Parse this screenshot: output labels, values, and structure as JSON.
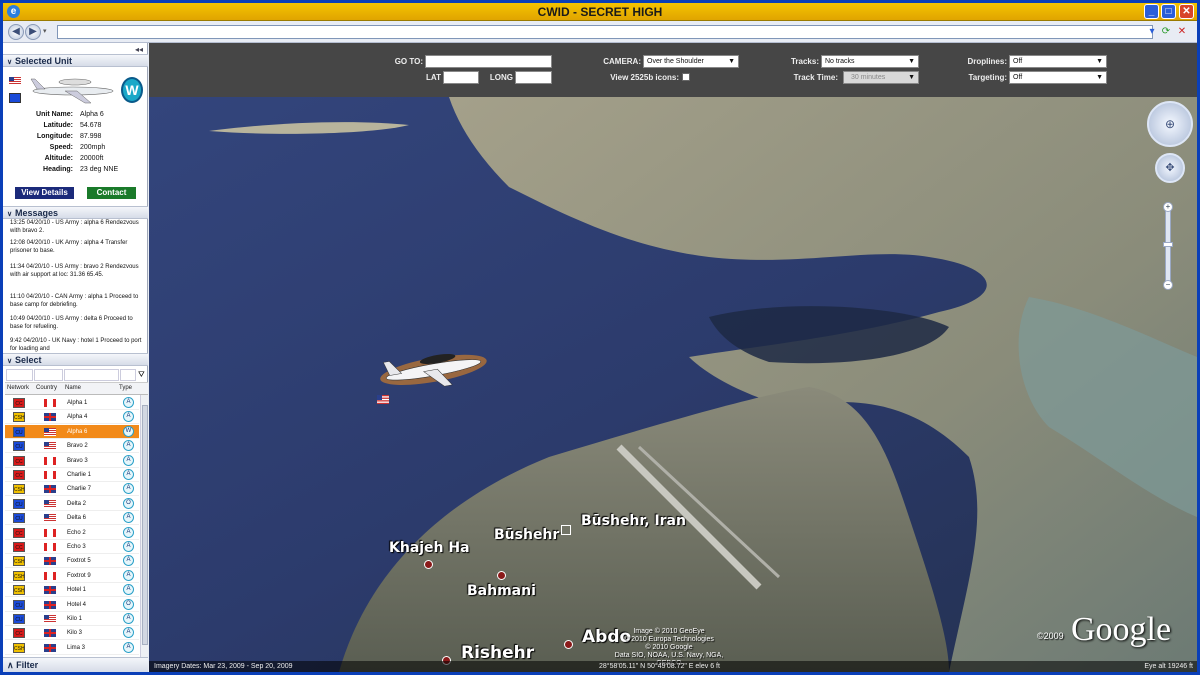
{
  "window": {
    "title": "CWID - SECRET HIGH"
  },
  "sidebar": {
    "selected_unit": {
      "heading": "Selected Unit",
      "role_badge": "W",
      "fields": [
        {
          "label": "Unit Name:",
          "value": "Alpha 6"
        },
        {
          "label": "Latitude:",
          "value": "54.678"
        },
        {
          "label": "Longitude:",
          "value": "87.998"
        },
        {
          "label": "Speed:",
          "value": "200mph"
        },
        {
          "label": "Altitude:",
          "value": "20000ft"
        },
        {
          "label": "Heading:",
          "value": "23 deg NNE"
        }
      ],
      "details_label": "View Details",
      "contact_label": "Contact"
    },
    "messages": {
      "heading": "Messages",
      "items": [
        "13:25 04/20/10 - US Army : alpha 6 Rendezvous with bravo 2.",
        "12:08 04/20/10 - UK Army : alpha 4 Transfer prisoner to base.",
        "11:34 04/20/10 - US Army : bravo 2 Rendezvous with air support at loc: 31.36 65.45.",
        "11:10 04/20/10 - CAN Army : alpha 1 Proceed to base camp for debriefing.",
        "10:49 04/20/10 - US Army : delta 6 Proceed to base for refueling.",
        "9:42 04/20/10 - UK Navy : hotel 1 Proceed to port for loading and"
      ]
    },
    "select": {
      "heading": "Select",
      "columns": [
        "Network",
        "Country",
        "Name",
        "Type"
      ],
      "rows": [
        {
          "network": "CC",
          "country": "ca",
          "name": "Alpha 1",
          "type": "A"
        },
        {
          "network": "CSH",
          "country": "gb",
          "name": "Alpha 4",
          "type": "A"
        },
        {
          "network": "CU",
          "country": "us",
          "name": "Alpha 6",
          "type": "W",
          "selected": true
        },
        {
          "network": "CU",
          "country": "us",
          "name": "Bravo 2",
          "type": "A"
        },
        {
          "network": "CC",
          "country": "ca",
          "name": "Bravo 3",
          "type": "A"
        },
        {
          "network": "CC",
          "country": "ca",
          "name": "Charlie 1",
          "type": "A"
        },
        {
          "network": "CSH",
          "country": "gb",
          "name": "Charlie 7",
          "type": "A"
        },
        {
          "network": "CU",
          "country": "us",
          "name": "Delta 2",
          "type": "O"
        },
        {
          "network": "CU",
          "country": "us",
          "name": "Delta 6",
          "type": "A"
        },
        {
          "network": "CC",
          "country": "ca",
          "name": "Echo 2",
          "type": "A"
        },
        {
          "network": "CC",
          "country": "ca",
          "name": "Echo 3",
          "type": "A"
        },
        {
          "network": "CSH",
          "country": "gb",
          "name": "Foxtrot 5",
          "type": "A"
        },
        {
          "network": "CSH",
          "country": "ca",
          "name": "Foxtrot 9",
          "type": "A"
        },
        {
          "network": "CSH",
          "country": "gb",
          "name": "Hotel 1",
          "type": "A"
        },
        {
          "network": "CU",
          "country": "gb",
          "name": "Hotel 4",
          "type": "O"
        },
        {
          "network": "CU",
          "country": "us",
          "name": "Kilo 1",
          "type": "A"
        },
        {
          "network": "CC",
          "country": "gb",
          "name": "Kilo 3",
          "type": "A"
        },
        {
          "network": "CSH",
          "country": "gb",
          "name": "Lima 3",
          "type": "A"
        }
      ]
    },
    "filter_heading": "Filter"
  },
  "controls": {
    "goto_label": "GO TO:",
    "lat_label": "LAT",
    "long_label": "LONG",
    "camera_label": "CAMERA:",
    "camera_value": "Over the Shoulder",
    "icons_label": "View 2525b icons:",
    "tracks_label": "Tracks:",
    "tracks_value": "No tracks",
    "track_time_label": "Track Time:",
    "track_time_value": "30 minutes",
    "droplines_label": "Droplines:",
    "droplines_value": "Off",
    "targeting_label": "Targeting:",
    "targeting_value": "Off"
  },
  "map": {
    "places": [
      "Khajeh Ha",
      "Būshehr",
      "Būshehr, Iran",
      "Bahmani",
      "Rishehr",
      "Abdo"
    ],
    "copyright_lines": [
      "Image © 2010 GeoEye",
      "© 2010 Europa Technologies",
      "© 2010 Google",
      "Data SIO, NOAA, U.S. Navy, NGA, GEBCO"
    ],
    "coords": "28°58'05.11\" N   50°49'08.72\" E    elev    6 ft",
    "imagery_dates": "Imagery Dates: Mar 23, 2009 - Sep 20, 2009",
    "eye_alt": "Eye alt   19246 ft",
    "copyright_year": "©2009",
    "logo": "Google"
  },
  "colors": {
    "title_bar": "#f0b800",
    "window_border": "#0a3fb8",
    "selected_row": "#f28a1a",
    "network_cc": "#d81a1a",
    "network_csh": "#f0c000",
    "network_cu": "#1a4ad8"
  }
}
